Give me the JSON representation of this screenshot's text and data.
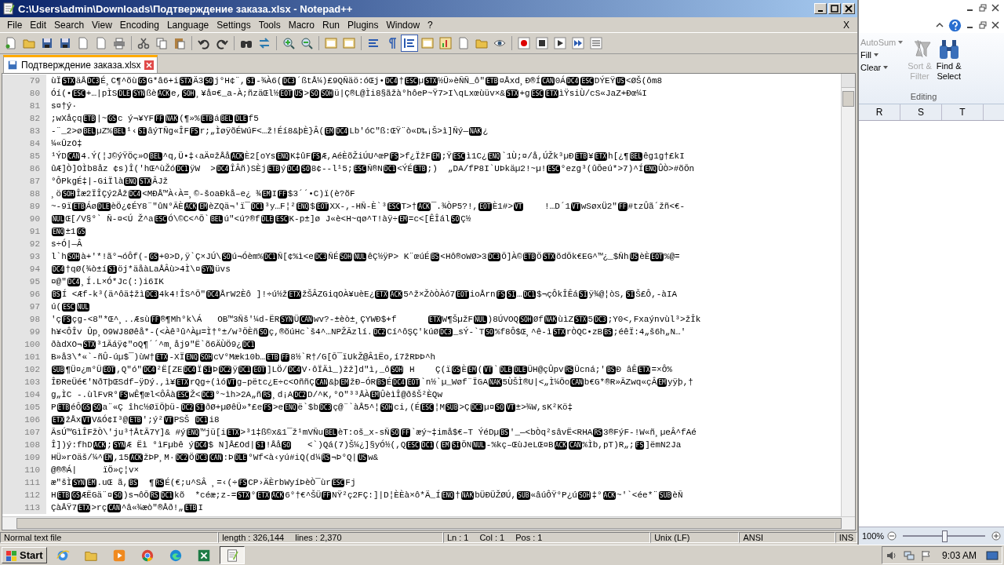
{
  "window": {
    "title": "C:\\Users\\admin\\Downloads\\Подтверждение заказа.xlsx - Notepad++",
    "close_document": "X"
  },
  "menu": [
    "File",
    "Edit",
    "Search",
    "View",
    "Encoding",
    "Language",
    "Settings",
    "Tools",
    "Macro",
    "Run",
    "Plugins",
    "Window",
    "?"
  ],
  "tabs": [
    {
      "label": "Подтверждение заказа.xlsx",
      "selected": true
    }
  ],
  "editor": {
    "lines": [
      {
        "number": "79",
        "segs": [
          "ùÏ",
          {
            "c": "STX"
          },
          "äÅ",
          {
            "c": "DC3"
          },
          "É¸C¶^õù",
          {
            "c": "GS"
          },
          "G*â6+i",
          {
            "c": "STX"
          },
          "Ä3",
          {
            "c": "SO"
          },
          "j°H¢¨,",
          {
            "c": "SI"
          },
          "-¾À6(",
          {
            "c": "DC3"
          },
          "´ßtÅ¼)£9QÑäö:óŒj•",
          {
            "c": "DC4"
          },
          "†",
          {
            "c": "ESC"
          },
          "µ",
          {
            "c": "STX"
          },
          "½Ü»èÑÑ_ô\"",
          {
            "c": "ETB"
          },
          "¤Åxd¸Ð®Í",
          {
            "c": "CAN"
          },
          "0Á",
          {
            "c": "DC4"
          },
          {
            "c": "ESC"
          },
          "DÝEŸ",
          {
            "c": "US"
          },
          "<ØŠ(ôm8"
        ]
      },
      {
        "number": "80",
        "segs": [
          "Óí(•",
          {
            "c": "ESC"
          },
          "+…|pÌS",
          {
            "c": "DLE"
          },
          {
            "c": "SYN"
          },
          "ßè",
          {
            "c": "ACK"
          },
          "e,",
          {
            "c": "SOH"
          },
          "¸¥å¤€_a-À;ñzäŒl½",
          {
            "c": "EOT"
          },
          {
            "c": "US"
          },
          ">",
          {
            "c": "SO"
          },
          {
            "c": "SOH"
          },
          "ü|Ç®L@Ìi8§ãžà°hôeP~Ÿ7>I\\qLxœùüv×&",
          {
            "c": "STX"
          },
          "+g",
          {
            "c": "ESC"
          },
          {
            "c": "ETX"
          },
          "ìŸsiÙ/cS«JaZ+Ðœ¼I"
        ]
      },
      {
        "number": "81",
        "segs": [
          "s¤†ý·"
        ]
      },
      {
        "number": "82",
        "segs": [
          ";wXåçq",
          {
            "c": "ETB"
          },
          "|~",
          {
            "c": "GS"
          },
          "c ý¬¥YF",
          {
            "c": "FF"
          },
          {
            "c": "NAK"
          },
          "(¶»%",
          {
            "c": "ETB"
          },
          "á",
          {
            "c": "BEL"
          },
          {
            "c": "DLE"
          },
          "f5"
        ]
      },
      {
        "number": "83",
        "segs": [
          "-¨_2>ø",
          {
            "c": "BEL"
          },
          "µZ%",
          {
            "c": "BEL"
          },
          "¹‹",
          {
            "c": "SI"
          },
          "âýTÑg«ÎF",
          {
            "c": "FS"
          },
          "r;„ÌøÿõÉWúF<…ž!Éí8&þÈ}Â(",
          {
            "c": "EM"
          },
          {
            "c": "DC4"
          },
          "Lb'óC″ß:ŒŸ¨ò«D‰¡Š>ì]Ñý—",
          {
            "c": "NAK"
          },
          "¿"
        ]
      },
      {
        "number": "84",
        "segs": [
          "¼«ŨzO‡"
        ]
      },
      {
        "number": "85",
        "segs": [
          "¹ÝD",
          {
            "c": "CAN"
          },
          "4.Ý(¦J©ýŸÖç»O",
          {
            "c": "BEL"
          },
          "^q,Ü•‡‹aÄ¤žÅå",
          {
            "c": "ACK"
          },
          "È2[oYs",
          {
            "c": "ENQ"
          },
          "K‡ûF",
          {
            "c": "FS"
          },
          "Æ,AéÈõŽiÚU^œP",
          {
            "c": "FS"
          },
          ">f¿ÏžF",
          {
            "c": "EM"
          },
          ";Ÿ",
          {
            "c": "ESC"
          },
          "ì1C¿",
          {
            "c": "ENQ"
          },
          "`1Ù;¤/å,ÚŽk³µÐ",
          {
            "c": "ETB"
          },
          "¥",
          {
            "c": "ETX"
          },
          "h[¿¶",
          {
            "c": "BEL"
          },
          "êg1g†£kI"
        ]
      },
      {
        "number": "86",
        "segs": [
          "ûÆ]Ò]OÌb8åz ¢s)Î('hŒ^ùŽó",
          {
            "c": "DC1"
          },
          "ÿW  >",
          {
            "c": "DC4"
          },
          "ÎÂñ)SÈj",
          {
            "c": "ETB"
          },
          "ý",
          {
            "c": "DC4"
          },
          {
            "c": "SO"
          },
          "8¢--l¹5;",
          {
            "c": "ESC"
          },
          "Ñ®N",
          {
            "c": "DC1"
          },
          "<ÝÉ",
          {
            "c": "ETB"
          },
          ";)  „DA/fP8I`UÞkäµ2!~µ!",
          {
            "c": "ESC"
          },
          "°ezg³(ûÕeú*>7)^Í",
          {
            "c": "ENQ"
          },
          "ÛÒ>#õÕn"
        ]
      },
      {
        "number": "87",
        "segs": [
          "°ÔPkgÉ‡|-GiÏlà",
          {
            "c": "ENQ"
          },
          {
            "c": "STX"
          },
          "ÂJž"
        ]
      },
      {
        "number": "88",
        "segs": [
          "¸ö",
          {
            "c": "SOH"
          },
          "Îæ2ÏÎÇý2Åž",
          {
            "c": "DC4"
          },
          "<MÐÅ™À‹À=¸©-šoaÐkå–e¿ ¾",
          {
            "c": "EM"
          },
          "I",
          {
            "c": "FF"
          },
          "$3´´•C)ï(è?õF"
        ]
      },
      {
        "number": "89",
        "segs": [
          "~-9ï",
          {
            "c": "ETB"
          },
          "Áø",
          {
            "c": "DLE"
          },
          "èÖ¿¢ÉY8¨″ûN°ÃÈ",
          {
            "c": "ACK"
          },
          {
            "c": "EM"
          },
          "èZQä¬'ï¯",
          {
            "c": "DC1"
          },
          "³y…F¦²",
          {
            "c": "ENQ"
          },
          "$",
          {
            "c": "EOT"
          },
          "XX-,-HÑ-È`³",
          {
            "c": "ESC"
          },
          "T>†",
          {
            "c": "ACK"
          },
          "¯.¾ÒP5?!,",
          {
            "c": "EOT"
          },
          "È1#>",
          {
            "c": "VT"
          },
          "    !…D´1",
          {
            "c": "VT"
          },
          "wSøxÜ2″",
          {
            "c": "FF"
          },
          "#tzÛã´žñ<€-"
        ]
      },
      {
        "number": "90",
        "segs": [
          {
            "c": "NUL"
          },
          "Œ[/V§°` Ñ-¤<Ú Ž^a",
          {
            "c": "ESC"
          },
          "Ó\\©C<^Õ`",
          {
            "c": "BEL"
          },
          "ú″<ú?®f",
          {
            "c": "DLE"
          },
          {
            "c": "ESC"
          },
          "K-p±]ø J«è<H~qø^T!àÿ÷",
          {
            "c": "EM"
          },
          "=c<[ÊÎál",
          {
            "c": "SO"
          },
          "Ç½"
        ]
      },
      {
        "number": "91",
        "segs": [
          {
            "c": "ENQ"
          },
          "±1",
          {
            "c": "GS"
          }
        ]
      },
      {
        "number": "92",
        "segs": [
          "s÷Ó|—Â"
        ]
      },
      {
        "number": "93",
        "segs": [
          "l`h",
          {
            "c": "SOH"
          },
          "à+'*!ã°¬óÔf(-",
          {
            "c": "GS"
          },
          "+0>D,ÿ`Ç×JÚ\\",
          {
            "c": "SO"
          },
          "ú¬Óèm%",
          {
            "c": "DC1"
          },
          "Ñ[¢%ì<e",
          {
            "c": "DC3"
          },
          "ÑÉ",
          {
            "c": "SOH"
          },
          {
            "c": "NUL"
          },
          "êÇ½ÿP> K¨œúÉ",
          {
            "c": "BS"
          },
          "<Hô®oWØ>3",
          {
            "c": "DC3"
          },
          "Õ]À©",
          {
            "c": "ETB"
          },
          "Ö",
          {
            "c": "STX"
          },
          "õdÕk€EG^™¿_$Ñh",
          {
            "c": "US"
          },
          "èÈ",
          {
            "c": "EOT"
          },
          "%@="
        ]
      },
      {
        "number": "94",
        "segs": [
          {
            "c": "DC4"
          },
          "†qØ(¾ò±í",
          {
            "c": "SI"
          },
          "öj*äåàLaÅÂù>4Ì\\¤",
          {
            "c": "SYN"
          },
          "üvs"
        ]
      },
      {
        "number": "95",
        "segs": [
          "¤@\"",
          {
            "c": "DC4"
          },
          "¸Í.L×Ó*Jc(:)i6IK"
        ]
      },
      {
        "number": "96",
        "segs": [
          {
            "c": "BS"
          },
          "Í <Æf-k³(ä^ôä‡žì",
          {
            "c": "DC3"
          },
          "4k4!ÎS^Õ″",
          {
            "c": "DC4"
          },
          "ÅrW2Èô ]!÷ú½ž",
          {
            "c": "ETX"
          },
          "žŠÂZGiqOÀ¥uèE¿",
          {
            "c": "ETX"
          },
          {
            "c": "ACK"
          },
          "5^ž×ŽòÒÀó7",
          {
            "c": "EOT"
          },
          "ioÅrn",
          {
            "c": "FS"
          },
          {
            "c": "SI"
          },
          "…",
          {
            "c": "DC1"
          },
          "$¬çÔkÎÊá",
          {
            "c": "SI"
          },
          "ÿ¾@¦òS,",
          {
            "c": "SI"
          },
          "Š£Ô,-àIA"
        ]
      },
      {
        "number": "97",
        "segs": [
          "ú(",
          {
            "c": "ESC"
          },
          {
            "c": "NUL"
          }
        ]
      },
      {
        "number": "98",
        "segs": [
          "'ç",
          {
            "c": "FS"
          },
          "çg-<8″*Œ^¸..Æsù",
          {
            "c": "FF"
          },
          "®¶Mh°k\\Á   OB™3Ñš'¼d-ËR",
          {
            "c": "SYN"
          },
          "Ü",
          {
            "c": "CAN"
          },
          "wv?-±èò±¸ÇYWÐ$+f      ",
          {
            "c": "ETX"
          },
          "W¶ŠµžF",
          {
            "c": "NUL"
          },
          ")8ÚVOQ",
          {
            "c": "SOH"
          },
          "Øf",
          {
            "c": "NAK"
          },
          "ùìZ",
          {
            "c": "STX"
          },
          "5",
          {
            "c": "DC3"
          },
          ";Y0<,Fxaýnvùl³>žÎk"
        ]
      },
      {
        "number": "99",
        "segs": [
          "h¥<ÔÎv Ûp¸O9WJ8Øêå*-(<Àê³û^Àµ=Ì†°±/w³ÖÈñ",
          {
            "c": "SO"
          },
          "ç,®õúHc`š4^…NPŽÃzlí.",
          {
            "c": "DC2"
          },
          "Cí^ôŞÇ'kúØ",
          {
            "c": "DC3"
          },
          "_sÝ-`T",
          {
            "c": "SO"
          },
          "%f8Ô$Œ¸^ê-ì",
          {
            "c": "STX"
          },
          "rÒQC•zB",
          {
            "c": "BS"
          },
          ";éêÏ:4„š6h„N…'"
        ]
      },
      {
        "number": "100",
        "segs": [
          "ðàdXO¬",
          {
            "c": "STX"
          },
          "³1Ãáÿ¢″oQ¶´´^m¸åj9″Ë`õ6ÄÙÖ9¿",
          {
            "c": "DC1"
          }
        ]
      },
      {
        "number": "101",
        "segs": [
          "B»å3\\*«`-ñÛ-úµ$¯)ùW†",
          {
            "c": "ETX"
          },
          "-XÏ",
          {
            "c": "ENQ"
          },
          {
            "c": "SOH"
          },
          "cV°Mæk10b…",
          {
            "c": "ETB"
          },
          {
            "c": "FF"
          },
          "8½`R†/G[Õ¯ïUkŽ@Â1Ëo,í7žRÞÞ^h"
        ]
      },
      {
        "number": "102",
        "segs": [
          {
            "c": "SUB"
          },
          "¶Ü¤¿m°Ü",
          {
            "c": "EOT"
          },
          ",Q″ó″",
          {
            "c": "DC4"
          },
          "²Ë[ZE",
          {
            "c": "DC4"
          },
          "Ï",
          {
            "c": "SI"
          },
          "Þ",
          {
            "c": "DC2"
          },
          "ÿ",
          {
            "c": "DC1"
          },
          {
            "c": "EOT"
          },
          "]LÖ/",
          {
            "c": "DC4"
          },
          "V·ôÏÄì_)žž]d″ì,_ô",
          {
            "c": "SOH"
          },
          " H    Ç(ï",
          {
            "c": "GS"
          },
          "È",
          {
            "c": "EM"
          },
          "(",
          {
            "c": "VT"
          },
          "`",
          {
            "c": "DLE"
          },
          {
            "c": "DLE"
          },
          "ÜH@çÛpv",
          {
            "c": "RS"
          },
          "Ücná;'",
          {
            "c": "BS"
          },
          "Ð âÊ",
          {
            "c": "ETX"
          },
          "=×Ô%"
        ]
      },
      {
        "number": "103",
        "segs": [
          "ÎÐReÜé€'NðTþŒSdf–ÿDý.,ì¥",
          {
            "c": "ETX"
          },
          "rQg÷(ìó",
          {
            "c": "VT"
          },
          "g–pëtc¿E÷c<OññÇ",
          {
            "c": "CAN"
          },
          "&þ",
          {
            "c": "EM"
          },
          "žÐ–ÓR",
          {
            "c": "BS"
          },
          "É",
          {
            "c": "DC4"
          },
          {
            "c": "EOT"
          },
          "`n½`µ_Wøf¨ÏGA",
          {
            "c": "NAK"
          },
          "5ÙŠÌ®U|<„Ì¼Öo",
          {
            "c": "CAN"
          },
          "b€G*®R»ÃZwq«çÂ",
          {
            "c": "EM"
          },
          "yÿþ,†"
        ]
      },
      {
        "number": "104",
        "segs": [
          "g„ÌC -.ùlFvR°",
          {
            "c": "FS"
          },
          "wÊ¶œl<ÔÂà",
          {
            "c": "ESC"
          },
          "Ž<",
          {
            "c": "DC3"
          },
          "°~ìh>2A„ñ",
          {
            "c": "RS"
          },
          "¸d¡A",
          {
            "c": "DC2"
          },
          "D/^K,°O″³³ÅÀ",
          {
            "c": "EM"
          },
          "ÛèìÎ@ðšŠ²ÈQw"
        ]
      },
      {
        "number": "105",
        "segs": [
          "P",
          {
            "c": "ETB"
          },
          "éÔ",
          {
            "c": "GS"
          },
          {
            "c": "SO"
          },
          "a¨«Ç îhc½ØïÖþü-",
          {
            "c": "DC2"
          },
          {
            "c": "SI"
          },
          "ðØ+µØêÜ»*£e",
          {
            "c": "FS"
          },
          ">e",
          {
            "c": "ENQ"
          },
          "ë`$b",
          {
            "c": "DC3"
          },
          "ç@¨`àÅ5^¦",
          {
            "c": "SOH"
          },
          "ci,(É",
          {
            "c": "ESC"
          },
          "¦M",
          {
            "c": "SUB"
          },
          ">Ç",
          {
            "c": "DC3"
          },
          "µ¤",
          {
            "c": "SO"
          },
          {
            "c": "VT"
          },
          "±>¾W,sK²Kö‡"
        ]
      },
      {
        "number": "106",
        "segs": [
          {
            "c": "ETX"
          },
          "žÅx",
          {
            "c": "VT"
          },
          "V&Ó¢I³@",
          {
            "c": "ETB"
          },
          "';ý²",
          {
            "c": "VT"
          },
          "PSŠ ",
          {
            "c": "DC1"
          },
          "i8"
        ]
      },
      {
        "number": "107",
        "segs": [
          "ÃsÚ™GìÎFžÒ\\'ju³†ÅtÃ7Y]& #ý",
          {
            "c": "ENQ"
          },
          "™jü[i",
          {
            "c": "ETX"
          },
          ">³1‡ß©x&1¯ž¹mVÑu",
          {
            "c": "BEL"
          },
          "èT:oš_x-sÑ",
          {
            "c": "SO"
          },
          {
            "c": "FF"
          },
          "`æý~‡imå$€–T ÝéDµ",
          {
            "c": "BS"
          },
          "'_—<bÒq²sâvË<RHA",
          {
            "c": "RS"
          },
          "3®FýF-!W«ñ¸µeÂ^fAé"
        ]
      },
      {
        "number": "108",
        "segs": [
          "Î])ý:fhD",
          {
            "c": "ACK"
          },
          ";",
          {
            "c": "SYN"
          },
          "Æ Ëì °ìFµbê ý",
          {
            "c": "DC4"
          },
          "$ N]Å£Od|",
          {
            "c": "SI"
          },
          "!Åå",
          {
            "c": "SO"
          },
          "   <`)Qá(7)Š¼¿]§yÓ½(,Q",
          {
            "c": "ESC"
          },
          {
            "c": "DC1"
          },
          "(",
          {
            "c": "EM"
          },
          {
            "c": "SI"
          },
          "ÖN",
          {
            "c": "NUL"
          },
          "-%kç–ŒùJeLŒ¤B",
          {
            "c": "ACK"
          },
          {
            "c": "CAN"
          },
          "%Ìb,pT)R„;",
          {
            "c": "FS"
          },
          "]ëmN2Ja"
        ]
      },
      {
        "number": "109",
        "segs": [
          "HÜ»rOäš/¼^",
          {
            "c": "EM"
          },
          ",15",
          {
            "c": "ACK"
          },
          "žÞP¸M·",
          {
            "c": "DC2"
          },
          "Ö",
          {
            "c": "DC3"
          },
          {
            "c": "CAN"
          },
          ":Þ",
          {
            "c": "DLE"
          },
          "°Wf<à‹yú#iQ(d¼",
          {
            "c": "RS"
          },
          "¬Þ°Q|",
          {
            "c": "US"
          },
          "w&"
        ]
      },
      {
        "number": "110",
        "segs": [
          "@®®Á|     ïÖ»ç¦v×"
        ]
      },
      {
        "number": "111",
        "segs": [
          "æ″šÌ",
          {
            "c": "SYN"
          },
          {
            "c": "EM"
          },
          ".uŒ ã,",
          {
            "c": "BS"
          },
          "  ¶",
          {
            "c": "RS"
          },
          "É(€;u^SÂ ¸=‹(÷",
          {
            "c": "FS"
          },
          "CP›ÄÈrbWyíÞèÒ¯ùr",
          {
            "c": "ESC"
          },
          "Fj"
        ]
      },
      {
        "number": "112",
        "segs": [
          "H",
          {
            "c": "ETB"
          },
          {
            "c": "GS"
          },
          "ÆËGä¨¤",
          {
            "c": "SO"
          },
          ")s¬ôÕ",
          {
            "c": "RS"
          },
          {
            "c": "DC1"
          },
          "kõ  *céæ;z-=",
          {
            "c": "STX"
          },
          "°",
          {
            "c": "ETX"
          },
          {
            "c": "ACK"
          },
          "6°†€^ŠÜ",
          {
            "c": "FF"
          },
          "NŸ²ç2FÇ:]|D¦ÈÈà×ô*Ä_Í",
          {
            "c": "ENQ"
          },
          "†",
          {
            "c": "NAK"
          },
          "bÜÐÜŽØÚ,",
          {
            "c": "SUB"
          },
          "«âúÔŸ°P¿ú",
          {
            "c": "SOH"
          },
          "‡°",
          {
            "c": "ACK"
          },
          "~'`<ée*¨",
          {
            "c": "SUB"
          },
          "èÑ"
        ]
      },
      {
        "number": "113",
        "segs": [
          "ÇàÅŸ7",
          {
            "c": "ETX"
          },
          ">rç",
          {
            "c": "CAN"
          },
          "^â«¾æò\"®Åð!„",
          {
            "c": "ETB"
          },
          "I"
        ]
      }
    ]
  },
  "status_bar": [
    "Normal text file",
    "length : 326,144",
    "lines : 2,370",
    "Ln : 1",
    "Col : 1",
    "Pos : 1",
    "Unix (LF)",
    "ANSI",
    "INS"
  ],
  "excel": {
    "autosum": "AutoSum",
    "fill": "Fill",
    "clear": "Clear",
    "sort": {
      "lines": [
        "Sort &",
        "Filter"
      ],
      "disabled": true
    },
    "find": {
      "lines": [
        "Find &",
        "Select"
      ],
      "disabled": false
    },
    "group": "Editing",
    "columns": [
      "R",
      "S",
      "T"
    ],
    "zoom": {
      "reading": "100%",
      "level": 0.5
    }
  },
  "taskbar": {
    "start": "Start",
    "apps": [
      {
        "kind": "ie",
        "selected": false
      },
      {
        "kind": "folder",
        "selected": false
      },
      {
        "kind": "media",
        "selected": false
      },
      {
        "kind": "chrome",
        "selected": false
      },
      {
        "kind": "edge",
        "selected": false
      },
      {
        "kind": "excel",
        "selected": false
      },
      {
        "kind": "notepad",
        "selected": true
      }
    ],
    "time": "9:03 AM"
  }
}
